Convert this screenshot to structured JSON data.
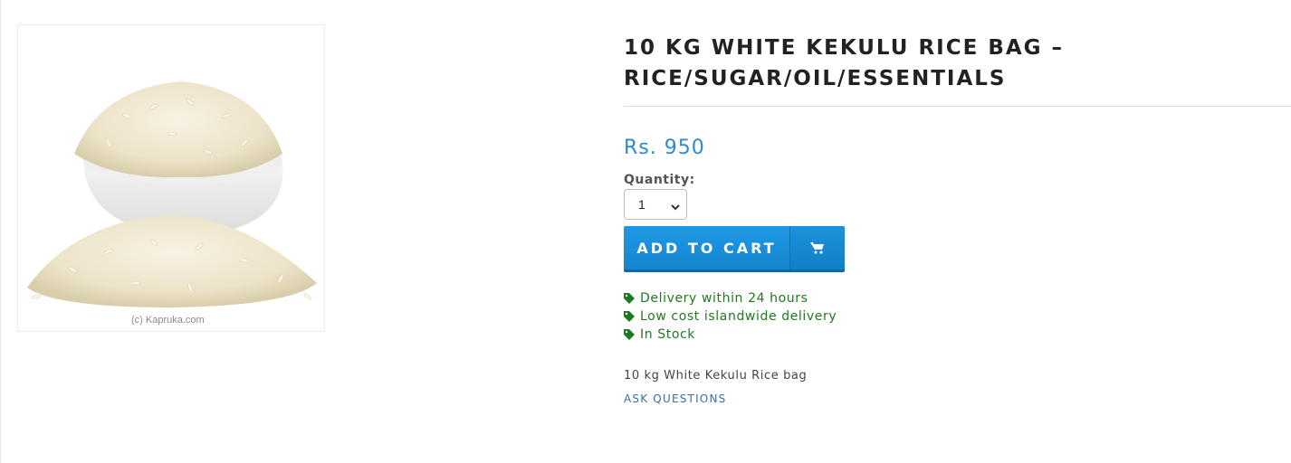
{
  "product": {
    "title": "10 KG WHITE KEKULU RICE BAG – RICE/SUGAR/OIL/ESSENTIALS",
    "price": "Rs. 950",
    "quantity_label": "Quantity:",
    "quantity_value": "1",
    "add_to_cart_label": "ADD TO CART",
    "cart_icon": "shopping-cart-icon",
    "features": [
      {
        "icon": "tag-icon",
        "text": "Delivery within 24 hours"
      },
      {
        "icon": "tag-icon",
        "text": "Low cost islandwide delivery"
      },
      {
        "icon": "tag-icon",
        "text": "In Stock"
      }
    ],
    "description": "10 kg White Kekulu Rice bag",
    "ask_questions_label": "ASK QUESTIONS"
  },
  "image": {
    "subject": "white rice in bowl",
    "watermark": "(c) Kapruka.com"
  },
  "colors": {
    "price": "#2a8bd0",
    "button": "#1a8fd8",
    "features": "#1f7a1f",
    "link": "#3b6ea5",
    "title": "#222222"
  }
}
